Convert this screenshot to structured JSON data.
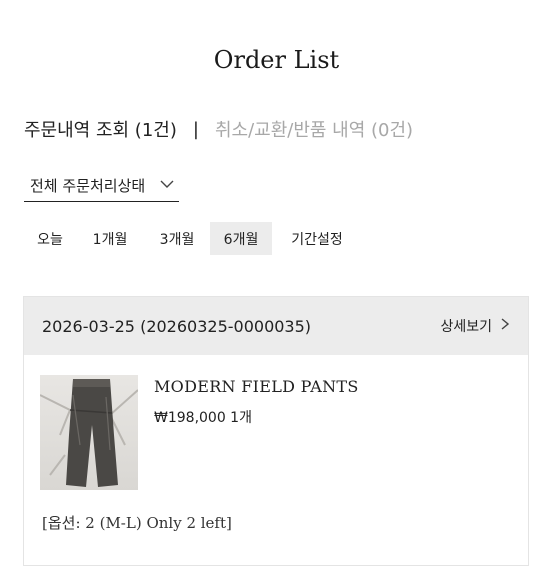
{
  "page": {
    "title": "Order List"
  },
  "tabs": {
    "orders": "주문내역 조회 (1건)",
    "separator": "|",
    "cancel_exchange": "취소/교환/반품 내역 (0건)"
  },
  "status_filter": {
    "value": "전체 주문처리상태",
    "icon": "chevron-down-icon"
  },
  "periods": [
    {
      "label": "오늘",
      "active": false
    },
    {
      "label": "1개월",
      "active": false
    },
    {
      "label": "3개월",
      "active": false
    },
    {
      "label": "6개월",
      "active": true
    },
    {
      "label": "기간설정",
      "active": false
    }
  ],
  "order": {
    "number": "2026-03-25 (20260325-0000035)",
    "detail_label": "상세보기",
    "product": {
      "name": "MODERN FIELD PANTS",
      "price_qty": "₩198,000 1개",
      "option": "[옵션: 2 (M-L) Only 2 left]"
    }
  },
  "colors": {
    "header_bg": "#ececec",
    "active_period_bg": "#ececec",
    "inactive_tab": "#a8a8a8"
  }
}
